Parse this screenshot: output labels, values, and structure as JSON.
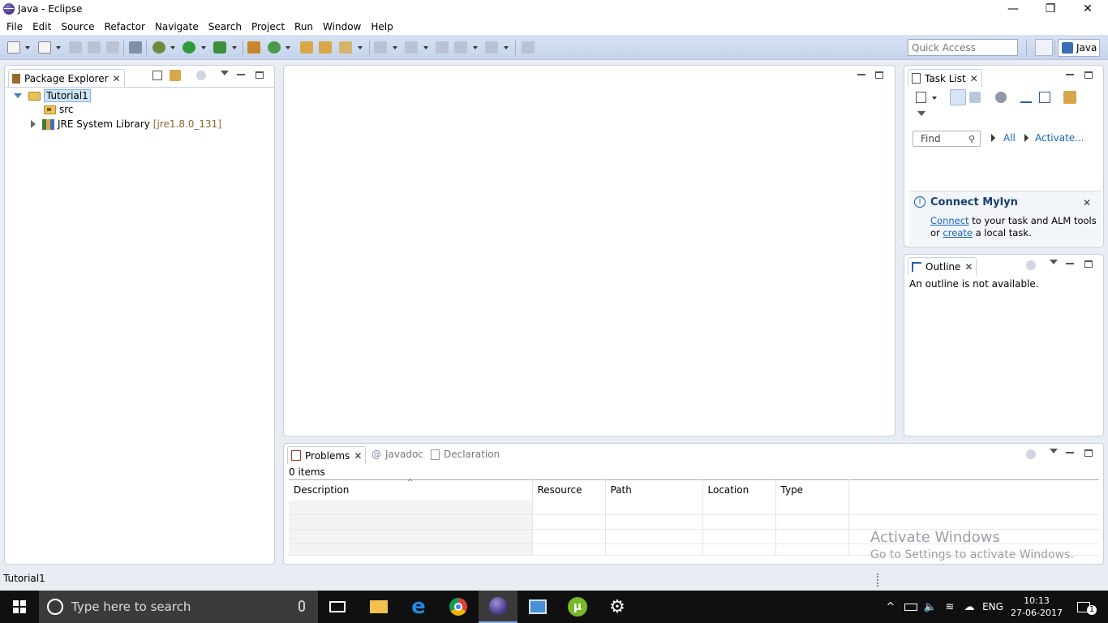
{
  "window": {
    "title": "Java - Eclipse"
  },
  "menu": [
    "File",
    "Edit",
    "Source",
    "Refactor",
    "Navigate",
    "Search",
    "Project",
    "Run",
    "Window",
    "Help"
  ],
  "toolbar": {
    "quick_access_placeholder": "Quick Access",
    "perspective": "Java"
  },
  "package_explorer": {
    "tab": "Package Explorer",
    "tree": [
      {
        "label": "Tutorial1"
      },
      {
        "label": "src"
      },
      {
        "label": "JRE System Library",
        "suffix": "[jre1.8.0_131]"
      }
    ]
  },
  "task_list": {
    "tab": "Task List",
    "find_placeholder": "Find",
    "all": "All",
    "activate": "Activate...",
    "mylyn": {
      "title": "Connect Mylyn",
      "connect": "Connect",
      "line1_rest": " to your task and ALM tools",
      "line2_pre": "or ",
      "create": "create",
      "line2_rest": " a local task."
    }
  },
  "outline": {
    "tab": "Outline",
    "message": "An outline is not available."
  },
  "bottom": {
    "tabs": [
      "Problems",
      "Javadoc",
      "Declaration"
    ],
    "count": "0 items",
    "columns": [
      "Description",
      "Resource",
      "Path",
      "Location",
      "Type"
    ]
  },
  "watermark": {
    "line1": "Activate Windows",
    "line2": "Go to Settings to activate Windows."
  },
  "status": {
    "text": "Tutorial1"
  },
  "taskbar": {
    "search_placeholder": "Type here to search",
    "lang": "ENG",
    "time": "10:13",
    "date": "27-06-2017",
    "notif_count": "1"
  },
  "colors": {
    "toolbar": "#c9d6ec",
    "taskbar": "#101010",
    "accent": "#1565c0"
  }
}
